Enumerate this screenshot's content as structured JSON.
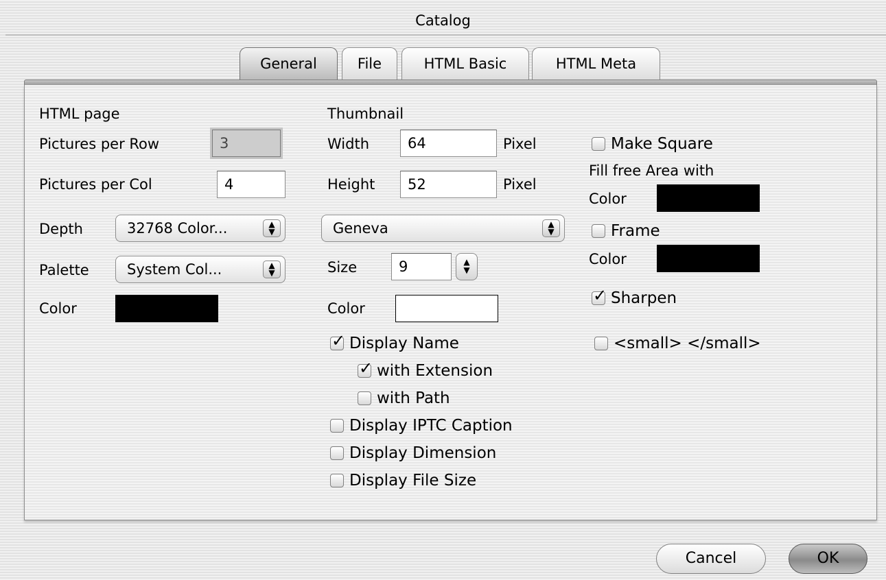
{
  "window": {
    "title": "Catalog"
  },
  "tabs": [
    {
      "label": "General",
      "active": true
    },
    {
      "label": "File",
      "active": false
    },
    {
      "label": "HTML Basic",
      "active": false
    },
    {
      "label": "HTML Meta",
      "active": false
    }
  ],
  "html_page": {
    "section_label": "HTML page",
    "pictures_per_row": {
      "label": "Pictures per Row",
      "value": "3"
    },
    "pictures_per_col": {
      "label": "Pictures per Col",
      "value": "4"
    },
    "depth": {
      "label": "Depth",
      "value": "32768 Color..."
    },
    "palette": {
      "label": "Palette",
      "value": "System Col..."
    },
    "color": {
      "label": "Color",
      "value": "#000000"
    }
  },
  "thumbnail": {
    "section_label": "Thumbnail",
    "width": {
      "label": "Width",
      "value": "64",
      "unit": "Pixel"
    },
    "height": {
      "label": "Height",
      "value": "52",
      "unit": "Pixel"
    },
    "font": {
      "value": "Geneva"
    },
    "size": {
      "label": "Size",
      "value": "9"
    },
    "color": {
      "label": "Color",
      "value": "#ffffff"
    },
    "display_name": {
      "label": "Display Name",
      "checked": true
    },
    "with_extension": {
      "label": "with Extension",
      "checked": true
    },
    "with_path": {
      "label": "with Path",
      "checked": false
    },
    "display_iptc_caption": {
      "label": "Display IPTC Caption",
      "checked": false
    },
    "display_dimension": {
      "label": "Display Dimension",
      "checked": false
    },
    "display_file_size": {
      "label": "Display File Size",
      "checked": false
    }
  },
  "options": {
    "make_square": {
      "label": "Make Square",
      "checked": false
    },
    "fill_free_area_label": "Fill free Area with",
    "fill_color": {
      "label": "Color",
      "value": "#000000"
    },
    "frame": {
      "label": "Frame",
      "checked": false
    },
    "frame_color": {
      "label": "Color",
      "value": "#000000"
    },
    "sharpen": {
      "label": "Sharpen",
      "checked": true
    },
    "small_tag": {
      "label": "<small> </small>",
      "checked": false
    }
  },
  "buttons": {
    "cancel": "Cancel",
    "ok": "OK"
  },
  "icons": {
    "popup_arrows": "up-down-arrows-icon",
    "check": "checkmark-icon"
  }
}
